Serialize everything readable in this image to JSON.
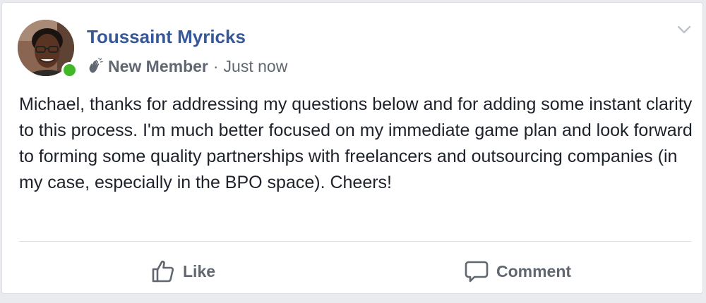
{
  "post": {
    "author": "Toussaint Myricks",
    "badge": "New Member",
    "separator": "·",
    "timestamp": "Just now",
    "body": "Michael, thanks for addressing my questions below and for adding some instant clarity to this process. I'm much better focused on my immediate game plan and look forward to forming some quality partnerships with freelancers and outsourcing companies (in my case, especially in the BPO space). Cheers!"
  },
  "actions": {
    "like_label": "Like",
    "comment_label": "Comment"
  },
  "icons": {
    "badge": "wave-hand-icon",
    "menu": "chevron-down-icon",
    "like": "thumbs-up-icon",
    "comment": "speech-bubble-icon"
  },
  "colors": {
    "author_link": "#365899",
    "online": "#42b72a",
    "secondary_text": "#616770",
    "body_text": "#1d2129"
  }
}
